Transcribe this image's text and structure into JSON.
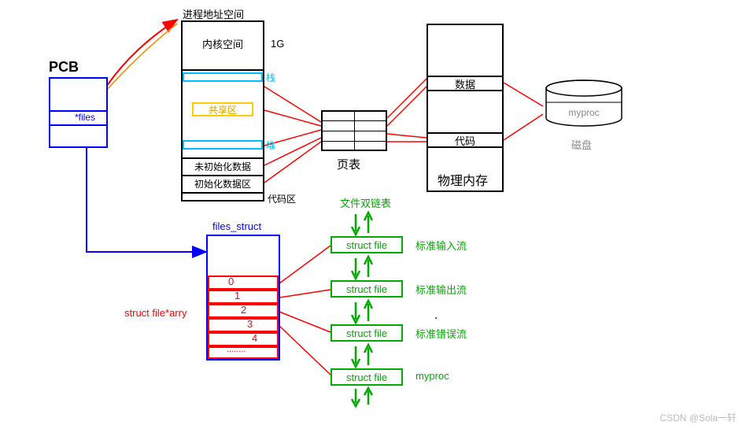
{
  "pcb": {
    "title": "PCB",
    "field": "*files"
  },
  "addrspace": {
    "title": "进程地址空间",
    "kernel": "内核空间",
    "size": "1G",
    "stack": "栈",
    "shared": "共享区",
    "heap": "堆",
    "bss": "未初始化数据",
    "data": "初始化数据区",
    "code": "代码区"
  },
  "pagetable": {
    "label": "页表"
  },
  "physmem": {
    "label": "物理内存",
    "data": "数据",
    "code": "代码"
  },
  "disk": {
    "label": "磁盘",
    "file": "myproc"
  },
  "files_struct": {
    "title": "files_struct",
    "arr_label": "struct file*arry",
    "indices": [
      "0",
      "1",
      "2",
      "3",
      "4",
      "........"
    ]
  },
  "filelist": {
    "header": "文件双链表",
    "node": "struct file",
    "desc": [
      "标准输入流",
      "标准输出流",
      "标准错误流",
      "myproc"
    ]
  },
  "watermark": "CSDN @Sola一轩"
}
